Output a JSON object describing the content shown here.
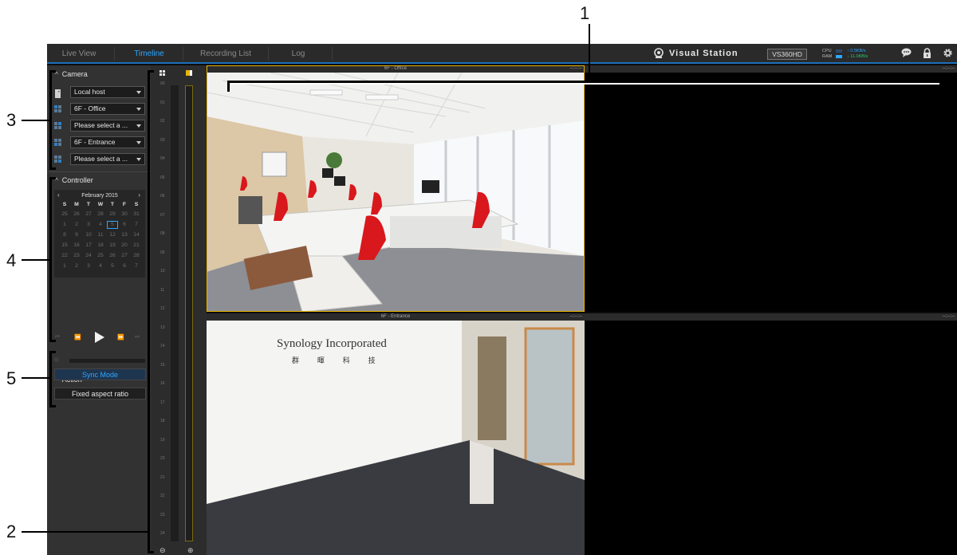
{
  "nav": {
    "tabs": [
      {
        "label": "Live View",
        "active": false
      },
      {
        "label": "Timeline",
        "active": true
      },
      {
        "label": "Recording List",
        "active": false
      },
      {
        "label": "Log",
        "active": false
      }
    ]
  },
  "brand": {
    "name": "Visual Station",
    "model": "VS360HD"
  },
  "stats": {
    "cpu_label": "CPU",
    "ram_label": "RAM",
    "upload": "0.5KB/s",
    "download": "11.0KB/s"
  },
  "icons": {
    "brand": "camera-icon",
    "chat": "chat-icon",
    "lock": "lock-icon",
    "settings": "gear-icon"
  },
  "camera": {
    "title": "Camera",
    "host": "Local host",
    "slots": [
      "6F - Office",
      "Please select a ...",
      "6F - Entrance",
      "Please select a ..."
    ]
  },
  "controller": {
    "title": "Controller",
    "month": "February 2015",
    "weekdays": [
      "S",
      "M",
      "T",
      "W",
      "T",
      "F",
      "S"
    ],
    "days": [
      [
        "25",
        "26",
        "27",
        "28",
        "29",
        "30",
        "31"
      ],
      [
        "1",
        "2",
        "3",
        "4",
        "5",
        "6",
        "7"
      ],
      [
        "8",
        "9",
        "10",
        "11",
        "12",
        "13",
        "14"
      ],
      [
        "15",
        "16",
        "17",
        "18",
        "19",
        "20",
        "21"
      ],
      [
        "22",
        "23",
        "24",
        "25",
        "26",
        "27",
        "28"
      ],
      [
        "1",
        "2",
        "3",
        "4",
        "5",
        "6",
        "7"
      ]
    ],
    "selected_day": "5"
  },
  "action": {
    "title": "Action",
    "sync_mode": "Sync Mode",
    "fixed_aspect": "Fixed aspect ratio"
  },
  "timeline": {
    "hours": [
      "00",
      "01",
      "02",
      "03",
      "04",
      "05",
      "06",
      "07",
      "08",
      "09",
      "10",
      "11",
      "12",
      "13",
      "14",
      "15",
      "16",
      "17",
      "18",
      "19",
      "20",
      "21",
      "22",
      "23",
      "24"
    ]
  },
  "tiles": [
    {
      "name": "6F - Office",
      "time": "--:--:--"
    },
    {
      "name": "",
      "time": "--:--:--"
    },
    {
      "name": "6F - Entrance",
      "time": "--:--:--"
    },
    {
      "name": "",
      "time": "--:--:--"
    }
  ],
  "entrance_sign": {
    "line1": "Synology Incorporated",
    "line2": "群 暉 科 技"
  },
  "callouts": [
    "1",
    "2",
    "3",
    "4",
    "5"
  ]
}
